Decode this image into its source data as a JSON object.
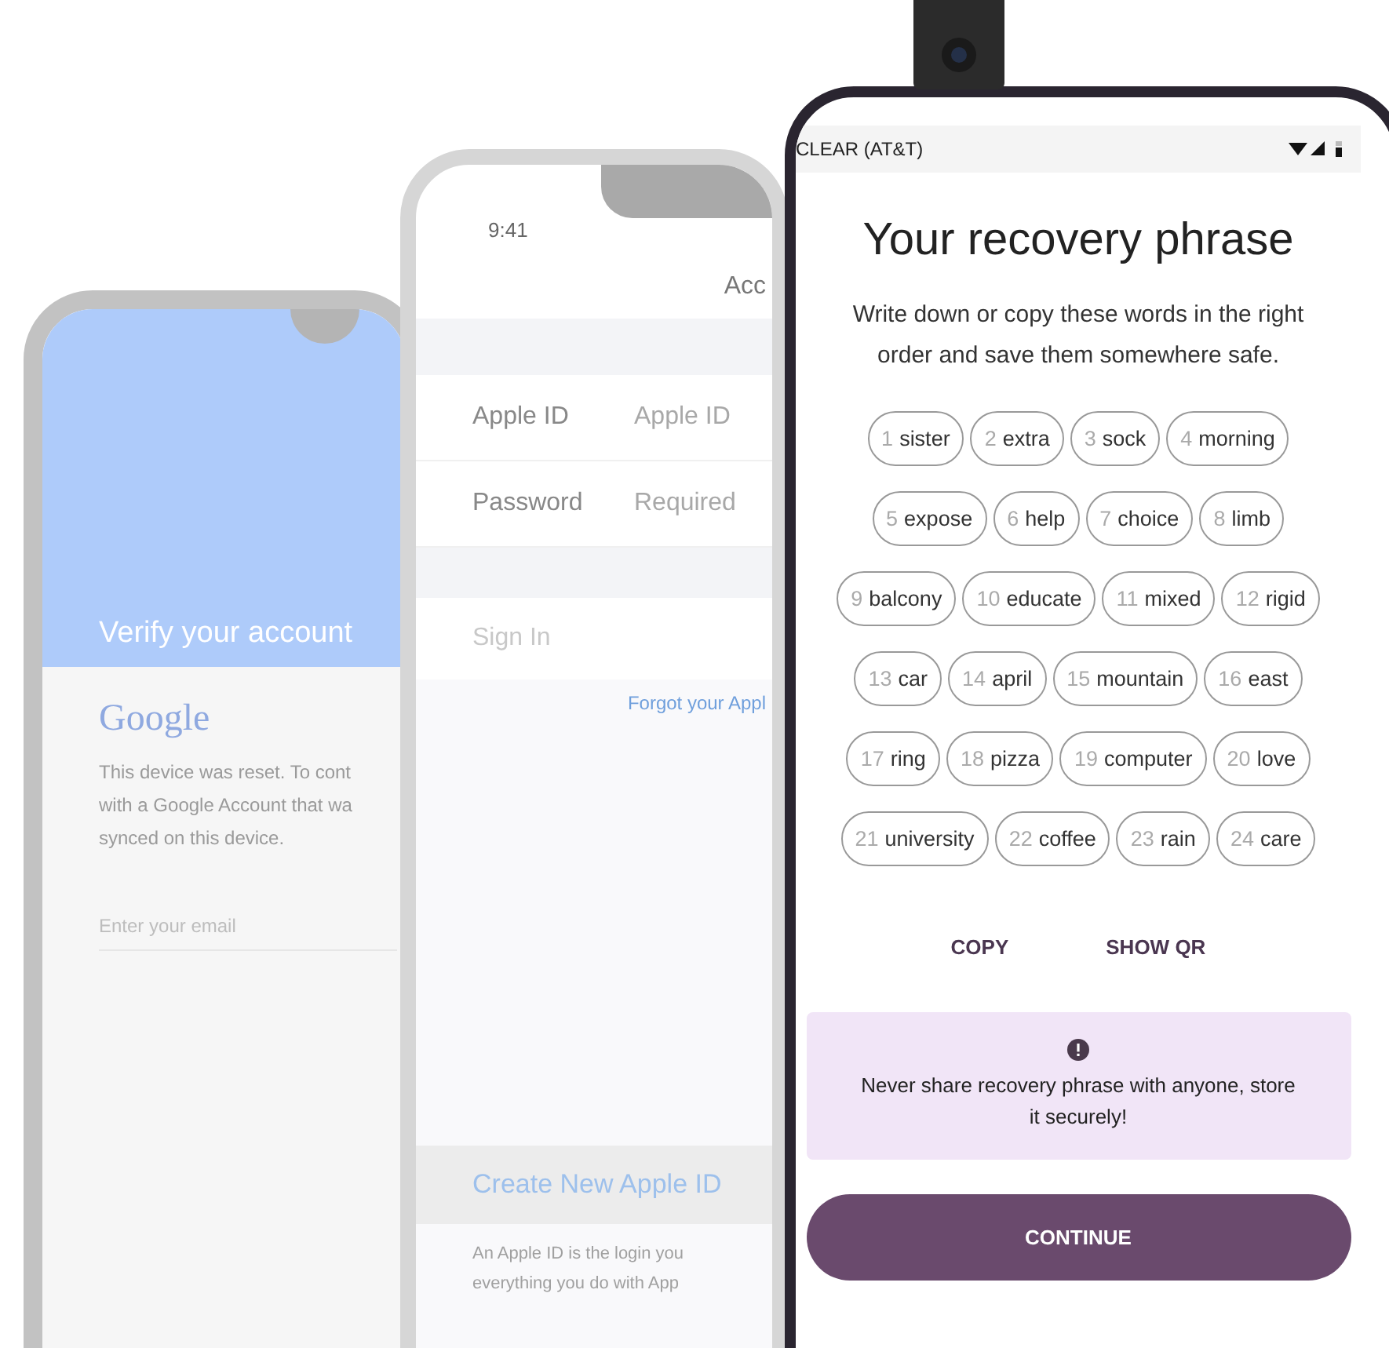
{
  "google_phone": {
    "header_title": "Verify your account",
    "logo": "Google",
    "message": "This device was reset. To cont\nwith a Google Account that wa\nsynced on this device.",
    "email_field": {
      "placeholder": "Enter your email"
    }
  },
  "apple_phone": {
    "time": "9:41",
    "nav_title": "Acc",
    "fields": [
      {
        "label": "Apple ID",
        "placeholder": "Apple ID"
      },
      {
        "label": "Password",
        "placeholder": "Required"
      }
    ],
    "sign_in": "Sign In",
    "forgot_link": "Forgot your Appl",
    "create_button": "Create New Apple ID",
    "footer_text": "An Apple ID is the login you\neverything you do with App"
  },
  "wallet_phone": {
    "carrier": "CLEAR (AT&T)",
    "title": "Your recovery phrase",
    "description": "Write down or copy these words in the right order and save them somewhere safe.",
    "words": [
      {
        "number": "1",
        "word": "sister"
      },
      {
        "number": "2",
        "word": "extra"
      },
      {
        "number": "3",
        "word": "sock"
      },
      {
        "number": "4",
        "word": "morning"
      },
      {
        "number": "5",
        "word": "expose"
      },
      {
        "number": "6",
        "word": "help"
      },
      {
        "number": "7",
        "word": "choice"
      },
      {
        "number": "8",
        "word": "limb"
      },
      {
        "number": "9",
        "word": "balcony"
      },
      {
        "number": "10",
        "word": "educate"
      },
      {
        "number": "11",
        "word": "mixed"
      },
      {
        "number": "12",
        "word": "rigid"
      },
      {
        "number": "13",
        "word": "car"
      },
      {
        "number": "14",
        "word": "april"
      },
      {
        "number": "15",
        "word": "mountain"
      },
      {
        "number": "16",
        "word": "east"
      },
      {
        "number": "17",
        "word": "ring"
      },
      {
        "number": "18",
        "word": "pizza"
      },
      {
        "number": "19",
        "word": "computer"
      },
      {
        "number": "20",
        "word": "love"
      },
      {
        "number": "21",
        "word": "university"
      },
      {
        "number": "22",
        "word": "coffee"
      },
      {
        "number": "23",
        "word": "rain"
      },
      {
        "number": "24",
        "word": "care"
      }
    ],
    "actions": [
      "COPY",
      "SHOW QR"
    ],
    "warning": "Never share recovery phrase with anyone, store it securely!",
    "continue_button": "CONTINUE"
  }
}
